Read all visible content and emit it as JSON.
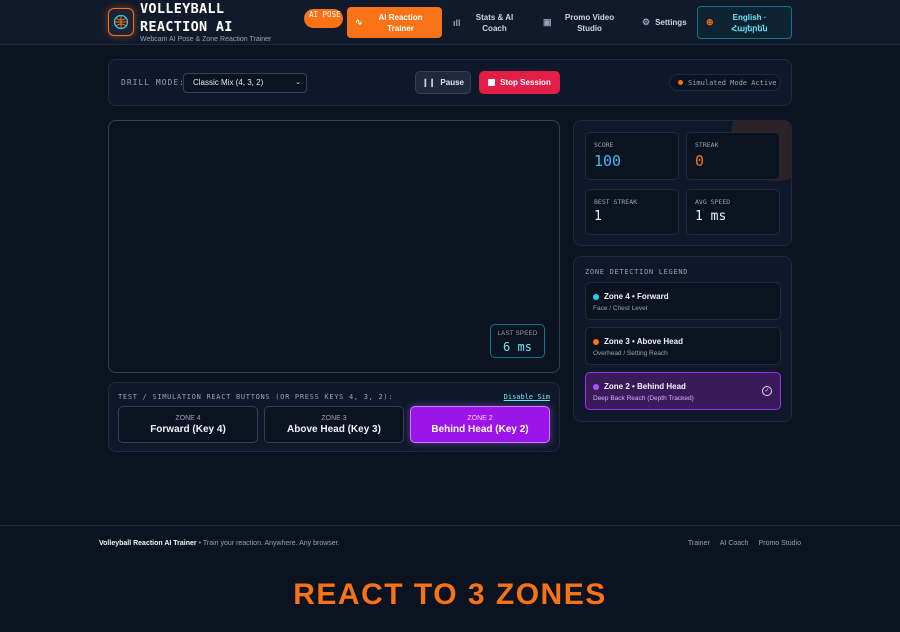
{
  "header": {
    "title": "VOLLEYBALL REACTION AI",
    "subtitle": "Webcam AI Pose & Zone Reaction Trainer",
    "badge": "AI POSE",
    "nav": [
      {
        "label": "AI Reaction Trainer",
        "icon": "activity-icon",
        "active": true
      },
      {
        "label": "Stats & AI Coach",
        "icon": "bar-chart-icon",
        "active": false
      },
      {
        "label": "Promo Video Studio",
        "icon": "film-icon",
        "active": false
      },
      {
        "label": "Settings",
        "icon": "gear-icon",
        "active": false
      }
    ],
    "language": "English · Հայերեն"
  },
  "controls": {
    "drill_label": "DRILL MODE:",
    "drill_value": "Classic Mix (4, 3, 2)",
    "pause_label": "Pause",
    "stop_label": "Stop Session",
    "sim_status": "Simulated Mode Active"
  },
  "video": {
    "last_speed_label": "LAST SPEED",
    "last_speed_value": "6 ms"
  },
  "test_panel": {
    "label": "TEST / SIMULATION REACT BUTTONS (OR PRESS KEYS 4, 3, 2):",
    "disable_label": "Disable Sim",
    "zones": [
      {
        "zone": "ZONE 4",
        "name": "Forward (Key 4)",
        "active": false
      },
      {
        "zone": "ZONE 3",
        "name": "Above Head (Key 3)",
        "active": false
      },
      {
        "zone": "ZONE 2",
        "name": "Behind Head (Key 2)",
        "active": true
      }
    ]
  },
  "stats": {
    "score_label": "SCORE",
    "score_value": "100",
    "streak_label": "STREAK",
    "streak_value": "0",
    "best_label": "BEST STREAK",
    "best_value": "1",
    "avg_label": "AVG SPEED",
    "avg_value": "1 ms"
  },
  "legend": {
    "title": "ZONE DETECTION LEGEND",
    "items": [
      {
        "title": "Zone 4 • Forward",
        "desc": "Face / Chest Level",
        "color": "#22d3ee",
        "active": false
      },
      {
        "title": "Zone 3 • Above Head",
        "desc": "Overhead / Setting Reach",
        "color": "#f97316",
        "active": false
      },
      {
        "title": "Zone 2 • Behind Head",
        "desc": "Deep Back Reach (Depth Tracked)",
        "color": "#a855f7",
        "active": true
      }
    ]
  },
  "footer": {
    "brand": "Volleyball Reaction AI Trainer",
    "tagline": " • Train your reaction. Anywhere. Any browser.",
    "links": [
      "Trainer",
      "AI Coach",
      "Promo Studio"
    ]
  },
  "promo_caption": "REACT TO 3 ZONES",
  "colors": {
    "accent": "#f97316",
    "cyan": "#22d3ee",
    "purple": "#a855f7",
    "danger": "#e11d48"
  }
}
